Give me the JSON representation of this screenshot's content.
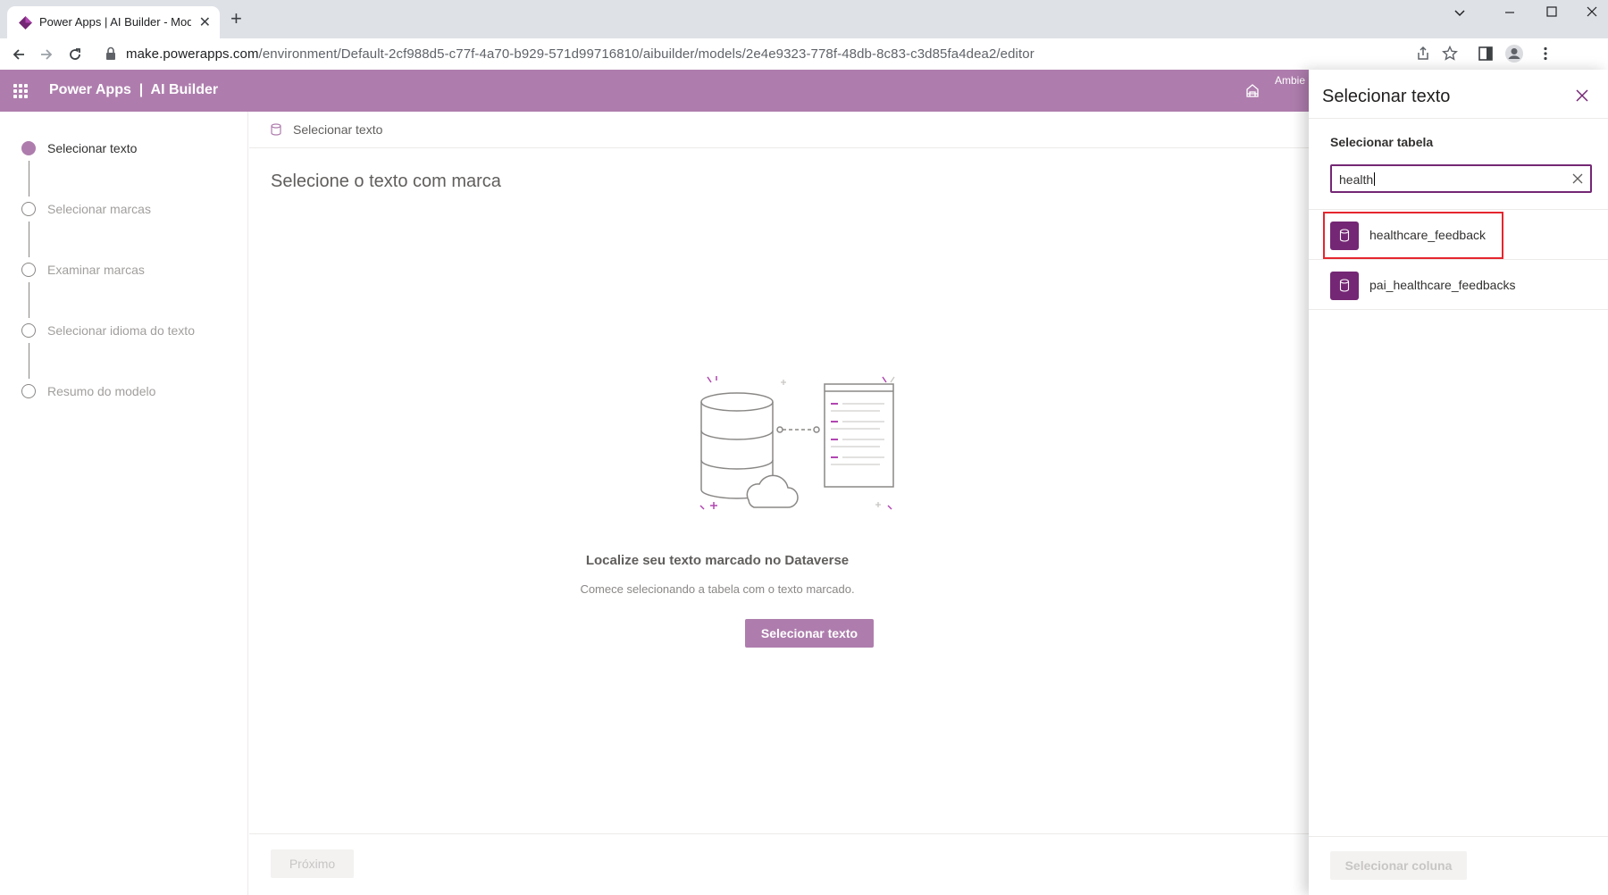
{
  "browser": {
    "tab_title": "Power Apps | AI Builder - Mod",
    "tab_close": "✕",
    "new_tab": "+",
    "url_host": "make.powerapps.com",
    "url_path": "/environment/Default-2cf988d5-c77f-4a70-b929-571d99716810/aibuilder/models/2e4e9323-778f-48db-8c83-c3d85fa4dea2/editor"
  },
  "header": {
    "title": "Power Apps  |  AI Builder",
    "environment_label": "Ambie"
  },
  "steps": [
    {
      "label": "Selecionar texto",
      "active": true
    },
    {
      "label": "Selecionar marcas",
      "active": false
    },
    {
      "label": "Examinar marcas",
      "active": false
    },
    {
      "label": "Selecionar idioma do texto",
      "active": false
    },
    {
      "label": "Resumo do modelo",
      "active": false
    }
  ],
  "main": {
    "breadcrumb": "Selecionar texto",
    "title": "Selecione o texto com marca",
    "empty_title": "Localize seu texto marcado no Dataverse",
    "empty_subtitle": "Comece selecionando a tabela com o texto marcado.",
    "primary_button": "Selecionar texto",
    "next_button": "Próximo"
  },
  "panel": {
    "title": "Selecionar texto",
    "field_label": "Selecionar tabela",
    "search_value": "health",
    "results": [
      {
        "label": "healthcare_feedback",
        "highlighted": true
      },
      {
        "label": "pai_healthcare_feedbacks",
        "highlighted": false
      }
    ],
    "footer_button": "Selecionar coluna"
  },
  "colors": {
    "header_bg": "#ae7dad",
    "accent": "#742774",
    "highlight_border": "#e5262e"
  }
}
